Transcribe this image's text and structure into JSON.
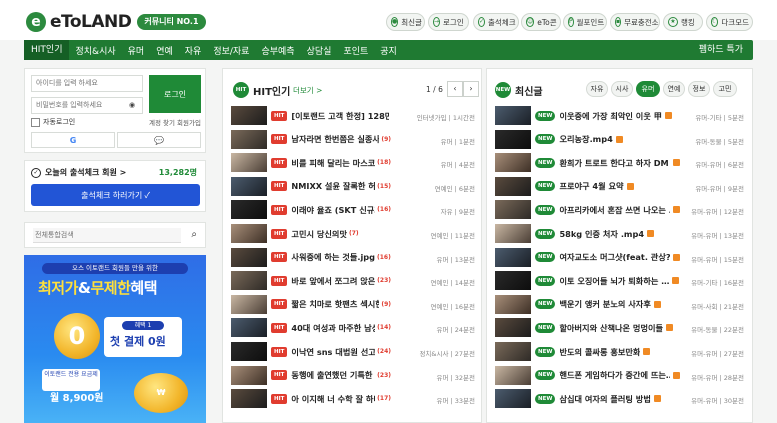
{
  "logo": {
    "text": "eToLAND",
    "badge": "커뮤니티 NO.1"
  },
  "quick_menu": [
    {
      "label": "최신글",
      "icon": "bell-icon"
    },
    {
      "label": "로그인",
      "icon": "login-icon"
    },
    {
      "label": "출석체크",
      "icon": "check-icon"
    },
    {
      "label": "eTo콘",
      "icon": "emoticon-icon"
    },
    {
      "label": "월포인트",
      "icon": "point-icon"
    },
    {
      "label": "무료충전소",
      "icon": "gift-icon"
    },
    {
      "label": "랭킹",
      "icon": "rank-icon"
    },
    {
      "label": "다크모드",
      "icon": "moon-icon"
    }
  ],
  "nav": {
    "items": [
      "HIT인기",
      "정치&시사",
      "유머",
      "연예",
      "자유",
      "정보/자료",
      "승부예측",
      "상담실",
      "포인트",
      "공지"
    ],
    "right": "펨하드 특가"
  },
  "login": {
    "id_placeholder": "아이디를 입력 하세요",
    "pw_placeholder": "비밀번호를 입력하세요",
    "login_button": "로그인",
    "auto_login": "자동로그인",
    "find_links": "계정 찾기 회원가입"
  },
  "attendance": {
    "title": "오늘의 출석체크 회원 >",
    "count": "13,282명",
    "button": "출석체크 하러가기"
  },
  "search": {
    "placeholder": "전체통합검색"
  },
  "banner": {
    "top_text": "오스 이토랜드 회원들 만을 위한",
    "main_a": "최저가",
    "main_b": "&",
    "main_c": "무제한",
    "main_d": "혜택",
    "coupon_label": "혜택 1",
    "coupon_value": "첫 결제 0원",
    "bottom_text": "이토랜드 전용 요금제",
    "price": "월 8,900원"
  },
  "hit_panel": {
    "tag": "HIT",
    "title": "HIT인기",
    "more": "더보기 >",
    "page": "1 / 6",
    "rows": [
      {
        "title": "[이토랜드 고객 한정] 128만원 …",
        "count": "",
        "meta": "인터넷가입 | 1시간전",
        "badge": "HIT"
      },
      {
        "title": "남자라면 한번쯤은 실종사건",
        "count": "(9)",
        "meta": "유머 | 1분전",
        "badge": "HIT"
      },
      {
        "title": "비를 피해 달리는 마스코트들",
        "count": "(18)",
        "meta": "유머 | 4분전",
        "badge": "HIT"
      },
      {
        "title": "NMIXX 설윤 잘록한 허리 여신 강…",
        "count": "(15)",
        "meta": "연예인 | 6분전",
        "badge": "HIT"
      },
      {
        "title": "이래야 율죠 (SKT 신규가입중단)",
        "count": "(16)",
        "meta": "자유 | 9분전",
        "badge": "HIT"
      },
      {
        "title": "고민시 당신의맛",
        "count": "(7)",
        "meta": "연예인 | 11분전",
        "badge": "HIT"
      },
      {
        "title": "사워중에 하는 것들.jpg",
        "count": "(16)",
        "meta": "유머 | 13분전",
        "badge": "HIT"
      },
      {
        "title": "바로 앞에서 쪼그려 앉은 ITZY …",
        "count": "(23)",
        "meta": "연예인 | 14분전",
        "badge": "HIT"
      },
      {
        "title": "짧은 치마로 핫팬츠 섹시한 허벅…",
        "count": "(9)",
        "meta": "연예인 | 16분전",
        "badge": "HIT"
      },
      {
        "title": "40대 여성과 마주한 남성들",
        "count": "(14)",
        "meta": "유머 | 24분전",
        "badge": "HIT"
      },
      {
        "title": "이낙연 sns 대법원 선고",
        "count": "(24)",
        "meta": "정치&시사 | 27분전",
        "badge": "HIT"
      },
      {
        "title": "동행에 출연했던 기특한 17살 누나…",
        "count": "(23)",
        "meta": "유머 | 32분전",
        "badge": "HIT"
      },
      {
        "title": "아 이지해 너 수학 잘 하냐",
        "count": "(17)",
        "meta": "유머 | 33분전",
        "badge": "HIT"
      }
    ]
  },
  "new_panel": {
    "tag": "NEW",
    "title": "최신글",
    "tabs": [
      "자유",
      "시사",
      "유머",
      "연예",
      "정보",
      "고민"
    ],
    "active_tab": "유머",
    "rows": [
      {
        "title": "이웃중에 가장 최악인 이웃 甲",
        "meta": "유머-기타 | 5분전"
      },
      {
        "title": "오리농장.mp4",
        "meta": "유머-동물 | 5분전"
      },
      {
        "title": "환희가 트로트 한다고 하자 DM …",
        "meta": "유머-유머 | 6분전"
      },
      {
        "title": "프로야구 4월 요약",
        "meta": "유머-유머 | 9분전"
      },
      {
        "title": "아프리카에서 혼잡 쓰면 나오는 …",
        "meta": "유머-유머 | 12분전"
      },
      {
        "title": "58kg 인증 처자 .mp4",
        "meta": "유머-유머 | 13분전"
      },
      {
        "title": "여자교도소 머그샷(feat. 관상?)",
        "meta": "유머-유머 | 15분전"
      },
      {
        "title": "이토 오징어들 뇌가 퇴화하는 …",
        "meta": "유머-기타 | 16분전"
      },
      {
        "title": "백운기 앵커 분노의 사자후",
        "meta": "유머-사회 | 21분전"
      },
      {
        "title": "할아버지와 산책나온 멍멍이들",
        "meta": "유머-동물 | 22분전"
      },
      {
        "title": "반도의 콜싸롱 홍보만화",
        "meta": "유머-유머 | 27분전"
      },
      {
        "title": "핸드폰 게임하다가 중간에 뜨는…",
        "meta": "유머-유머 | 28분전"
      },
      {
        "title": "삼십대 여자의 플러팅 방법",
        "meta": "유머-유머 | 30분전"
      }
    ]
  },
  "colors": {
    "brand_green": "#1f8a37",
    "hit_red": "#e03c2f",
    "attend_blue": "#2255d6"
  }
}
